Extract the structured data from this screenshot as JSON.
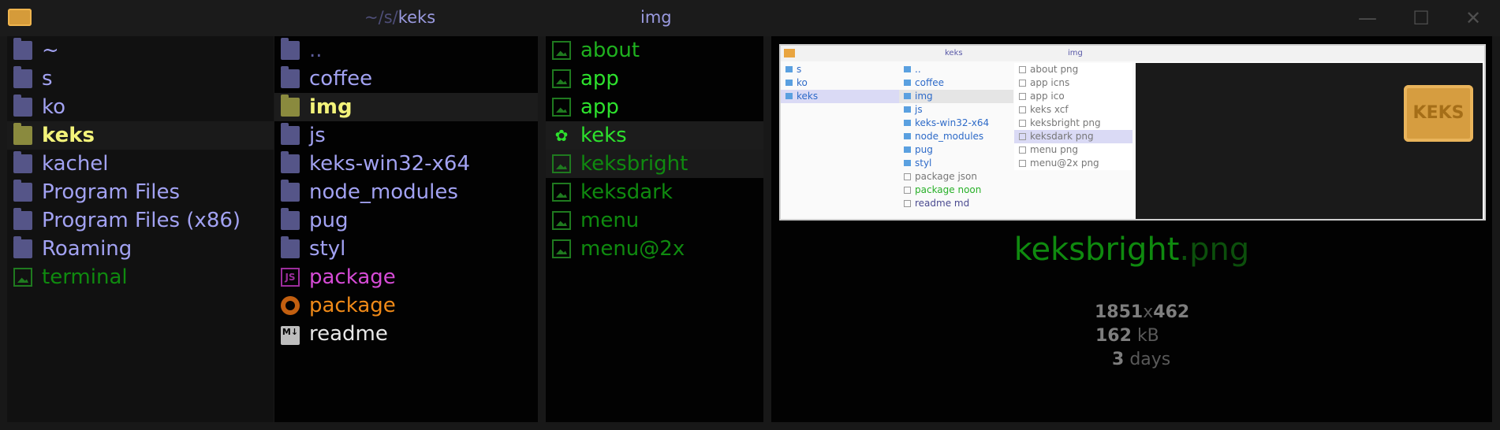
{
  "titlebar": {
    "crumb_tilde": "~",
    "sep1": "/",
    "crumb_s": "s",
    "sep2": "/",
    "crumb_keks": "keks",
    "current": "img",
    "minimize": "—",
    "maximize": "☐",
    "close": "✕"
  },
  "col1": [
    {
      "label": "~",
      "type": "folder"
    },
    {
      "label": "s",
      "type": "folder"
    },
    {
      "label": "ko",
      "type": "folder"
    },
    {
      "label": "keks",
      "type": "folder",
      "selected": true
    },
    {
      "label": "kachel",
      "type": "folder"
    },
    {
      "label": "Program Files",
      "type": "folder"
    },
    {
      "label": "Program Files (x86)",
      "type": "folder"
    },
    {
      "label": "Roaming",
      "type": "folder"
    },
    {
      "label": "terminal",
      "type": "image"
    }
  ],
  "col2": [
    {
      "label": "..",
      "type": "folder"
    },
    {
      "label": "coffee",
      "type": "folder"
    },
    {
      "label": "img",
      "type": "folder",
      "selected": true
    },
    {
      "label": "js",
      "type": "folder"
    },
    {
      "label": "keks-win32-x64",
      "type": "folder"
    },
    {
      "label": "node_modules",
      "type": "folder"
    },
    {
      "label": "pug",
      "type": "folder"
    },
    {
      "label": "styl",
      "type": "folder"
    },
    {
      "label": "package",
      "type": "js"
    },
    {
      "label": "package",
      "type": "noon"
    },
    {
      "label": "readme",
      "type": "md"
    }
  ],
  "col3": [
    {
      "label": "about",
      "type": "image"
    },
    {
      "label": "app",
      "type": "image"
    },
    {
      "label": "app",
      "type": "image"
    },
    {
      "label": "keks",
      "type": "keks"
    },
    {
      "label": "keksbright",
      "type": "image",
      "selected": true
    },
    {
      "label": "keksdark",
      "type": "image"
    },
    {
      "label": "menu",
      "type": "image"
    },
    {
      "label": "menu@2x",
      "type": "image"
    }
  ],
  "preview": {
    "filename": "keksbright",
    "ext": ".png",
    "width": "1851",
    "x": "x",
    "height": "462",
    "size": "162",
    "size_unit": "kB",
    "age": "3",
    "age_unit": "days",
    "mini": {
      "title_left": "keks",
      "title_right": "img",
      "col1": [
        "s",
        "ko",
        "keks"
      ],
      "col2": [
        "..",
        "coffee",
        "img",
        "js",
        "keks-win32-x64",
        "node_modules",
        "pug",
        "styl",
        "package json",
        "package noon",
        "readme md"
      ],
      "col3": [
        "about png",
        "app icns",
        "app ico",
        "keks xcf",
        "keksbright png",
        "keksdark png",
        "menu png",
        "menu@2x png"
      ],
      "biscuit_text": "KEKS"
    }
  }
}
